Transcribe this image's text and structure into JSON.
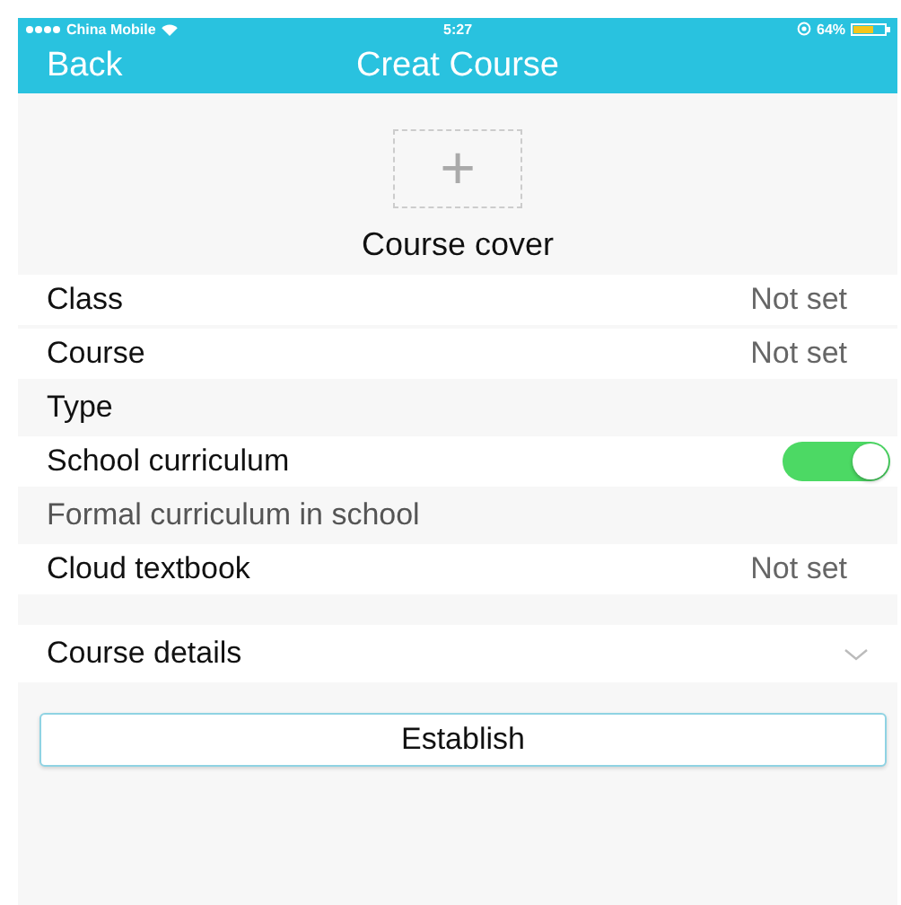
{
  "status_bar": {
    "carrier": "China Mobile",
    "time": "5:27",
    "battery": "64%"
  },
  "nav": {
    "back": "Back",
    "title": "Creat Course"
  },
  "cover": {
    "icon": "+",
    "label": "Course cover"
  },
  "rows": [
    {
      "kind": "value",
      "label": "Class",
      "value": "Not set"
    },
    {
      "kind": "value",
      "label": "Course",
      "value": "Not set"
    },
    {
      "kind": "header",
      "label": "Type"
    },
    {
      "kind": "toggle",
      "label": "School curriculum",
      "on": true
    },
    {
      "kind": "note",
      "label": "Formal curriculum in school"
    },
    {
      "kind": "value",
      "label": "Cloud textbook",
      "value": "Not set"
    },
    {
      "kind": "gap"
    },
    {
      "kind": "expand",
      "label": "Course details",
      "expanded": false
    }
  ],
  "button": {
    "label": "Establish"
  }
}
